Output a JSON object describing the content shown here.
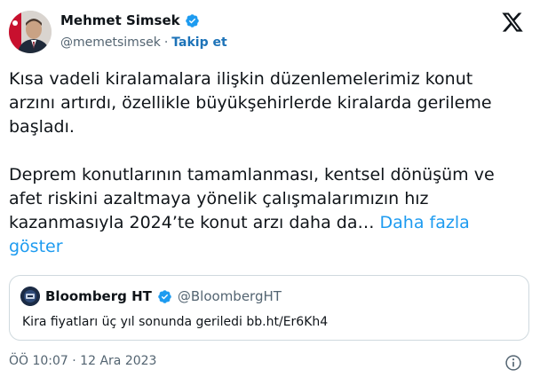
{
  "author": {
    "name": "Mehmet Simsek",
    "handle": "@memetsimsek",
    "separator": "·",
    "follow_label": "Takip et",
    "avatar_icon": "avatar-photo",
    "verified_icon": "verified-badge-icon"
  },
  "tweet": {
    "paragraph_1": "Kısa vadeli kiralamalara ilişkin düzenlemelerimiz konut arzını artırdı, özellikle büyükşehirlerde kiralarda gerileme başladı.",
    "paragraph_2": "Deprem konutlarının tamamlanması, kentsel dönüşüm ve afet riskini azaltmaya yönelik çalışmalarımızın hız kazanmasıyla 2024’te konut arzı daha da…",
    "more_label": "Daha fazla göster"
  },
  "quote": {
    "name": "Bloomberg HT",
    "handle": "@BloombergHT",
    "text": "Kira fiyatları üç yıl sonunda geriledi bb.ht/Er6Kh4"
  },
  "meta": {
    "timestamp": "ÖÖ 10:07 · 12 Ara 2023"
  },
  "colors": {
    "link": "#1d9bf0",
    "follow": "#1d73b8",
    "verified": "#1d9bf0",
    "secondary_text": "#536471"
  }
}
